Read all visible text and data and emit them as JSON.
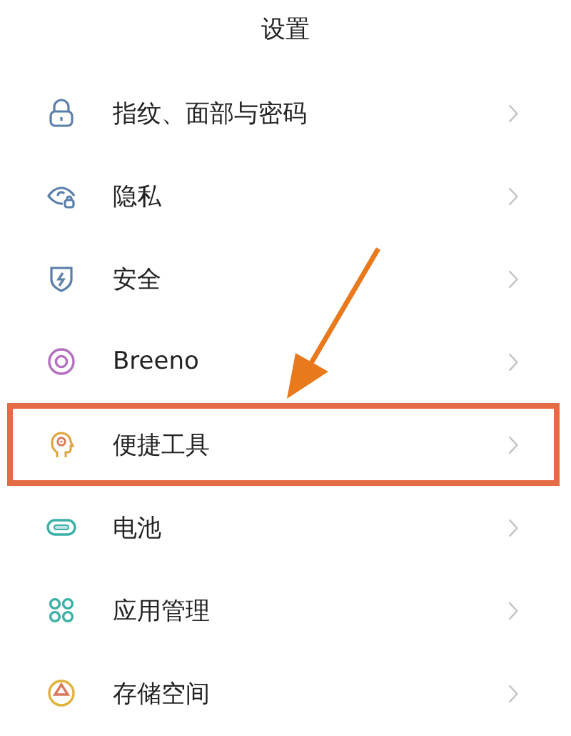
{
  "header": {
    "title": "设置"
  },
  "items": [
    {
      "kind": "lock",
      "label": "指纹、面部与密码",
      "highlighted": false
    },
    {
      "kind": "privacy",
      "label": "隐私",
      "highlighted": false
    },
    {
      "kind": "shield",
      "label": "安全",
      "highlighted": false
    },
    {
      "kind": "ring",
      "label": "Breeno",
      "highlighted": false
    },
    {
      "kind": "head",
      "label": "便捷工具",
      "highlighted": true
    },
    {
      "kind": "battery",
      "label": "电池",
      "highlighted": false
    },
    {
      "kind": "apps",
      "label": "应用管理",
      "highlighted": false
    },
    {
      "kind": "storage",
      "label": "存储空间",
      "highlighted": false
    }
  ]
}
